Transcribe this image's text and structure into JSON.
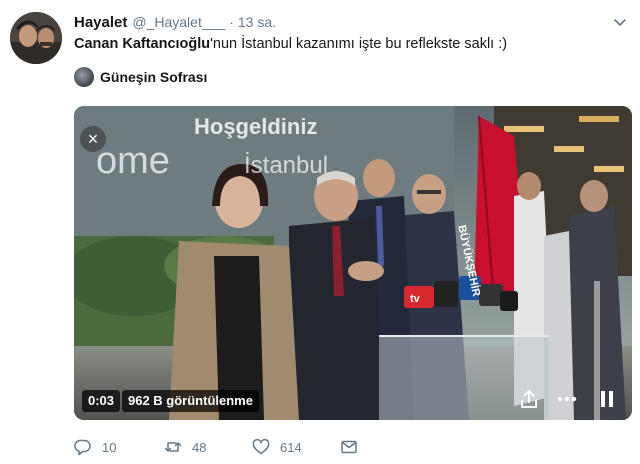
{
  "tweet": {
    "display_name": "Hayalet",
    "handle": "@_Hayalet___",
    "separator": "·",
    "time": "13 sa.",
    "mention": "Canan Kaftancıoğlu",
    "text_rest": "'nun İstanbul kazanımı işte bu reflekste saklı :)"
  },
  "source": {
    "name": "Güneşin Sofrası"
  },
  "video": {
    "time": "0:03",
    "views": "962 B görüntülenme",
    "banner_line1": "Hoşgeldiniz",
    "banner_line2": "ome",
    "banner_line3": "İstanbul",
    "flag_text": "BÜYÜKŞEHİR",
    "mic_label": "tv"
  },
  "actions": {
    "replies": "10",
    "retweets": "48",
    "likes": "614"
  },
  "colors": {
    "text": "#14171a",
    "secondary": "#657786",
    "flag_red": "#c8102e"
  },
  "icons": [
    "caret-down-icon",
    "close-icon",
    "share-icon",
    "more-icon",
    "pause-icon",
    "reply-icon",
    "retweet-icon",
    "like-icon",
    "message-icon"
  ]
}
